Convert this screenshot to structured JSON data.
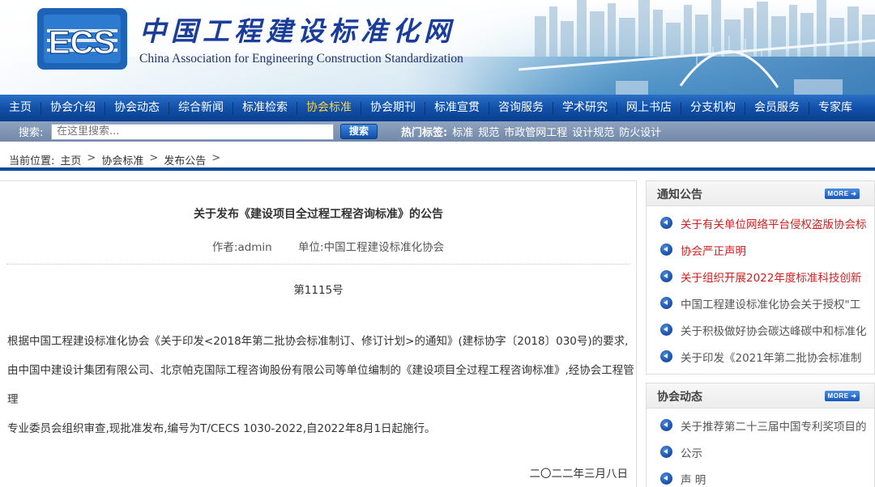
{
  "site": {
    "logo_text": "ECS",
    "title": "中国工程建设标准化网",
    "subtitle": "China Association for Engineering Construction Standardization"
  },
  "nav": {
    "items": [
      {
        "label": "主页",
        "active": false
      },
      {
        "label": "协会介绍",
        "active": false
      },
      {
        "label": "协会动态",
        "active": false
      },
      {
        "label": "综合新闻",
        "active": false
      },
      {
        "label": "标准检索",
        "active": false
      },
      {
        "label": "协会标准",
        "active": true
      },
      {
        "label": "协会期刊",
        "active": false
      },
      {
        "label": "标准宣贯",
        "active": false
      },
      {
        "label": "咨询服务",
        "active": false
      },
      {
        "label": "学术研究",
        "active": false
      },
      {
        "label": "网上书店",
        "active": false
      },
      {
        "label": "分支机构",
        "active": false
      },
      {
        "label": "会员服务",
        "active": false
      },
      {
        "label": "专家库",
        "active": false
      }
    ]
  },
  "search": {
    "label": "搜索:",
    "placeholder": "在这里搜索...",
    "button": "搜索",
    "hot_label": "热门标签:",
    "hot_tags": [
      "标准",
      "规范",
      "市政管网工程",
      "设计规范",
      "防火设计"
    ]
  },
  "breadcrumb": {
    "prefix": "当前位置:",
    "items": [
      "主页",
      "协会标准",
      "发布公告"
    ],
    "separator": ">"
  },
  "article": {
    "title": "关于发布《建设项目全过程工程咨询标准》的公告",
    "author": "作者:admin",
    "unit": "单位:中国工程建设标准化协会",
    "number": "第1115号",
    "body_lines": [
      "根据中国工程建设标准化协会《关于印发<2018年第二批协会标准制订、修订计划>的通知》(建标协字〔2018〕030号)的要求,",
      "由中国中建设计集团有限公司、北京帕克国际工程咨询股份有限公司等单位编制的《建设项目全过程工程咨询标准》,经协会工程管理",
      "专业委员会组织审查,现批准发布,编号为T/CECS 1030-2022,自2022年8月1日起施行。"
    ],
    "date": "二〇二二年三月八日"
  },
  "sidebar": {
    "notices": {
      "title": "通知公告",
      "more": "MORE",
      "items": [
        {
          "text": "关于有关单位网络平台侵权盗版协会标",
          "highlight": true
        },
        {
          "text": "协会严正声明",
          "highlight": true
        },
        {
          "text": "关于组织开展2022年度标准科技创新",
          "highlight": true
        },
        {
          "text": "中国工程建设标准化协会关于授权\"工",
          "highlight": false
        },
        {
          "text": "关于积极做好协会碳达峰碳中和标准化",
          "highlight": false
        },
        {
          "text": "关于印发《2021年第二批协会标准制",
          "highlight": false
        }
      ]
    },
    "news": {
      "title": "协会动态",
      "more": "MORE",
      "items": [
        {
          "text": "关于推荐第二十三届中国专利奖项目的",
          "highlight": false
        },
        {
          "text": "公示",
          "highlight": false
        },
        {
          "text": "声 明",
          "highlight": false
        }
      ]
    }
  },
  "colors": {
    "nav_bg": "#1150a8",
    "nav_active": "#ffd23a",
    "title_blue": "#1b3d9a",
    "notice_red": "#d11e1e",
    "rule_blue": "#0d4a9c"
  }
}
